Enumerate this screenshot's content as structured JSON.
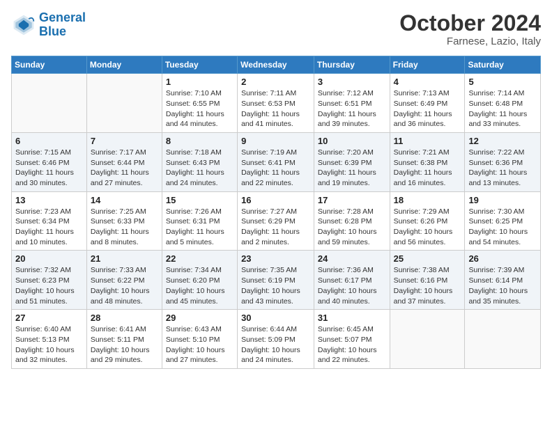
{
  "logo": {
    "line1": "General",
    "line2": "Blue"
  },
  "title": "October 2024",
  "subtitle": "Farnese, Lazio, Italy",
  "days_of_week": [
    "Sunday",
    "Monday",
    "Tuesday",
    "Wednesday",
    "Thursday",
    "Friday",
    "Saturday"
  ],
  "weeks": [
    [
      {
        "day": "",
        "info": ""
      },
      {
        "day": "",
        "info": ""
      },
      {
        "day": "1",
        "info": "Sunrise: 7:10 AM\nSunset: 6:55 PM\nDaylight: 11 hours and 44 minutes."
      },
      {
        "day": "2",
        "info": "Sunrise: 7:11 AM\nSunset: 6:53 PM\nDaylight: 11 hours and 41 minutes."
      },
      {
        "day": "3",
        "info": "Sunrise: 7:12 AM\nSunset: 6:51 PM\nDaylight: 11 hours and 39 minutes."
      },
      {
        "day": "4",
        "info": "Sunrise: 7:13 AM\nSunset: 6:49 PM\nDaylight: 11 hours and 36 minutes."
      },
      {
        "day": "5",
        "info": "Sunrise: 7:14 AM\nSunset: 6:48 PM\nDaylight: 11 hours and 33 minutes."
      }
    ],
    [
      {
        "day": "6",
        "info": "Sunrise: 7:15 AM\nSunset: 6:46 PM\nDaylight: 11 hours and 30 minutes."
      },
      {
        "day": "7",
        "info": "Sunrise: 7:17 AM\nSunset: 6:44 PM\nDaylight: 11 hours and 27 minutes."
      },
      {
        "day": "8",
        "info": "Sunrise: 7:18 AM\nSunset: 6:43 PM\nDaylight: 11 hours and 24 minutes."
      },
      {
        "day": "9",
        "info": "Sunrise: 7:19 AM\nSunset: 6:41 PM\nDaylight: 11 hours and 22 minutes."
      },
      {
        "day": "10",
        "info": "Sunrise: 7:20 AM\nSunset: 6:39 PM\nDaylight: 11 hours and 19 minutes."
      },
      {
        "day": "11",
        "info": "Sunrise: 7:21 AM\nSunset: 6:38 PM\nDaylight: 11 hours and 16 minutes."
      },
      {
        "day": "12",
        "info": "Sunrise: 7:22 AM\nSunset: 6:36 PM\nDaylight: 11 hours and 13 minutes."
      }
    ],
    [
      {
        "day": "13",
        "info": "Sunrise: 7:23 AM\nSunset: 6:34 PM\nDaylight: 11 hours and 10 minutes."
      },
      {
        "day": "14",
        "info": "Sunrise: 7:25 AM\nSunset: 6:33 PM\nDaylight: 11 hours and 8 minutes."
      },
      {
        "day": "15",
        "info": "Sunrise: 7:26 AM\nSunset: 6:31 PM\nDaylight: 11 hours and 5 minutes."
      },
      {
        "day": "16",
        "info": "Sunrise: 7:27 AM\nSunset: 6:29 PM\nDaylight: 11 hours and 2 minutes."
      },
      {
        "day": "17",
        "info": "Sunrise: 7:28 AM\nSunset: 6:28 PM\nDaylight: 10 hours and 59 minutes."
      },
      {
        "day": "18",
        "info": "Sunrise: 7:29 AM\nSunset: 6:26 PM\nDaylight: 10 hours and 56 minutes."
      },
      {
        "day": "19",
        "info": "Sunrise: 7:30 AM\nSunset: 6:25 PM\nDaylight: 10 hours and 54 minutes."
      }
    ],
    [
      {
        "day": "20",
        "info": "Sunrise: 7:32 AM\nSunset: 6:23 PM\nDaylight: 10 hours and 51 minutes."
      },
      {
        "day": "21",
        "info": "Sunrise: 7:33 AM\nSunset: 6:22 PM\nDaylight: 10 hours and 48 minutes."
      },
      {
        "day": "22",
        "info": "Sunrise: 7:34 AM\nSunset: 6:20 PM\nDaylight: 10 hours and 45 minutes."
      },
      {
        "day": "23",
        "info": "Sunrise: 7:35 AM\nSunset: 6:19 PM\nDaylight: 10 hours and 43 minutes."
      },
      {
        "day": "24",
        "info": "Sunrise: 7:36 AM\nSunset: 6:17 PM\nDaylight: 10 hours and 40 minutes."
      },
      {
        "day": "25",
        "info": "Sunrise: 7:38 AM\nSunset: 6:16 PM\nDaylight: 10 hours and 37 minutes."
      },
      {
        "day": "26",
        "info": "Sunrise: 7:39 AM\nSunset: 6:14 PM\nDaylight: 10 hours and 35 minutes."
      }
    ],
    [
      {
        "day": "27",
        "info": "Sunrise: 6:40 AM\nSunset: 5:13 PM\nDaylight: 10 hours and 32 minutes."
      },
      {
        "day": "28",
        "info": "Sunrise: 6:41 AM\nSunset: 5:11 PM\nDaylight: 10 hours and 29 minutes."
      },
      {
        "day": "29",
        "info": "Sunrise: 6:43 AM\nSunset: 5:10 PM\nDaylight: 10 hours and 27 minutes."
      },
      {
        "day": "30",
        "info": "Sunrise: 6:44 AM\nSunset: 5:09 PM\nDaylight: 10 hours and 24 minutes."
      },
      {
        "day": "31",
        "info": "Sunrise: 6:45 AM\nSunset: 5:07 PM\nDaylight: 10 hours and 22 minutes."
      },
      {
        "day": "",
        "info": ""
      },
      {
        "day": "",
        "info": ""
      }
    ]
  ]
}
